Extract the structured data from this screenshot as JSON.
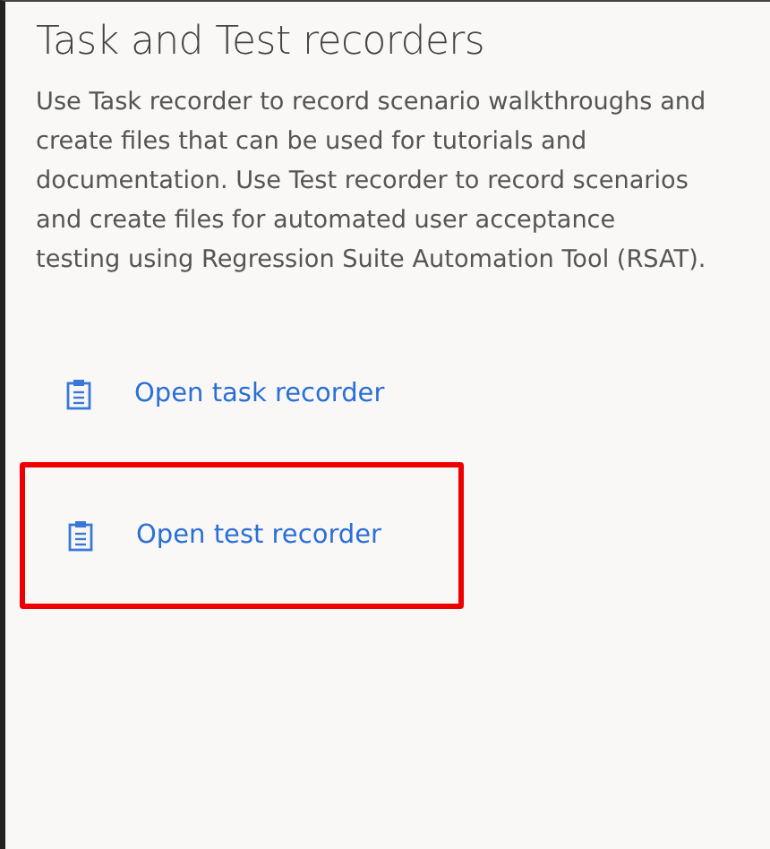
{
  "title": "Task and Test recorders",
  "description": "Use Task recorder to record scenario walkthroughs and create files that can be used for tutorials and documentation. Use Test recorder to record scenarios and create files for automated user acceptance testing using Regression Suite Automation Tool (RSAT).",
  "links": [
    {
      "label": "Open task recorder",
      "highlighted": false
    },
    {
      "label": "Open test recorder",
      "highlighted": true
    }
  ]
}
